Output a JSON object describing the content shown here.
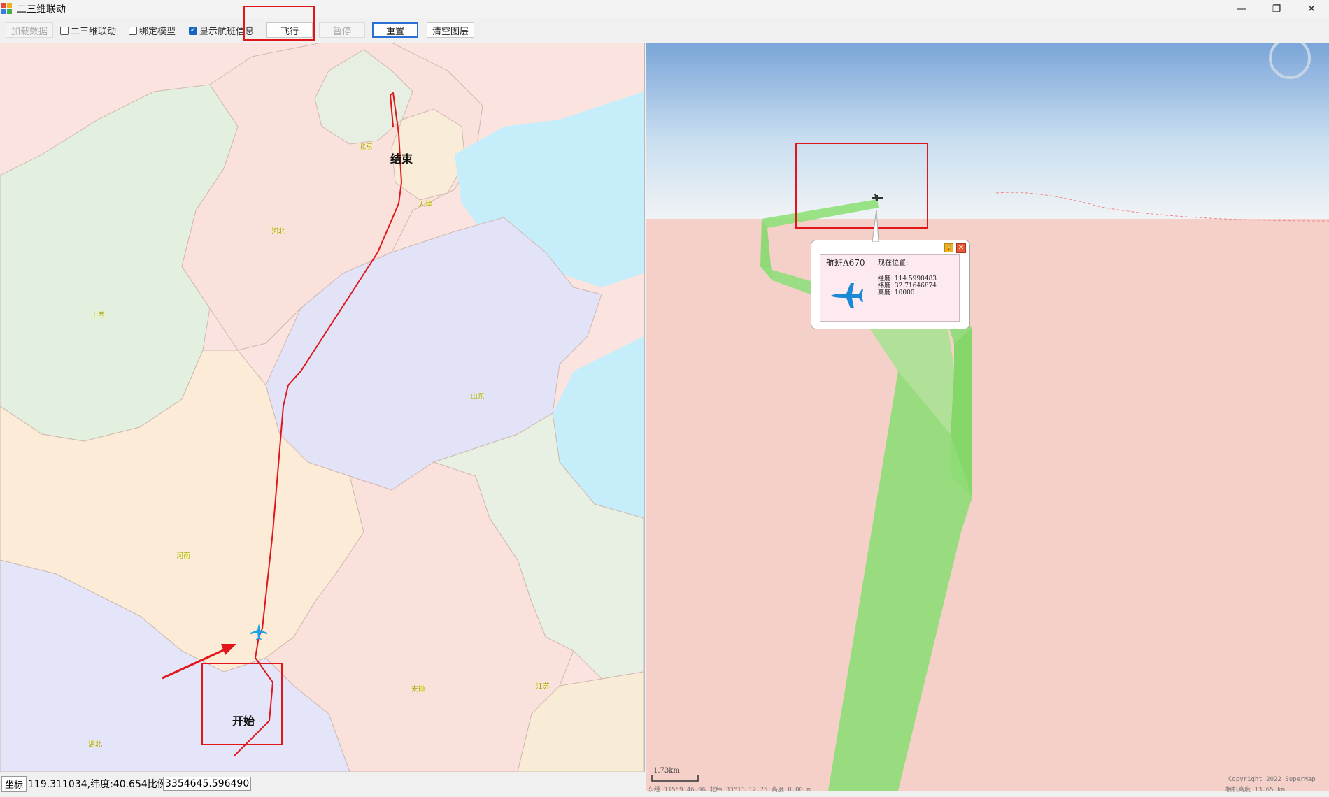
{
  "window": {
    "title": "二三维联动",
    "controls": {
      "minimize": "—",
      "restore": "❐",
      "close": "✕"
    }
  },
  "toolbar": {
    "load_data": "加载数据",
    "link_2d3d": "二三维联动",
    "bind_model": "绑定模型",
    "show_flight_info": "显示航班信息",
    "fly": "飞行",
    "pause": "暂停",
    "reset": "重置",
    "clear_layer": "清空图层"
  },
  "map2d": {
    "provinces": {
      "beijing": "北京",
      "tianjin": "天津",
      "hebei": "河北",
      "shanxi": "山西",
      "shandong": "山东",
      "henan": "河南",
      "anhui": "安徽",
      "jiangsu": "江苏",
      "hubei": "湖北"
    },
    "start_label": "开始",
    "end_label": "结束"
  },
  "popup": {
    "flight": "航班A670",
    "header": "现在位置:",
    "longitude": "经度: 114.5990483",
    "latitude": "纬度: 32.71646874",
    "altitude": "高度: 10000"
  },
  "map3d": {
    "scale": "1.73km",
    "footer_left": "东经 115°9   46.96   北纬 33°13   12.75  高度 0.00 m",
    "footer_right_1": "Copyright 2022 SuperMap",
    "footer_right_2": "相机高度 13.65 km"
  },
  "status": {
    "label": "坐标",
    "coords": "119.311034,纬度:40.654比例尺",
    "scale": "3354645.596490"
  }
}
